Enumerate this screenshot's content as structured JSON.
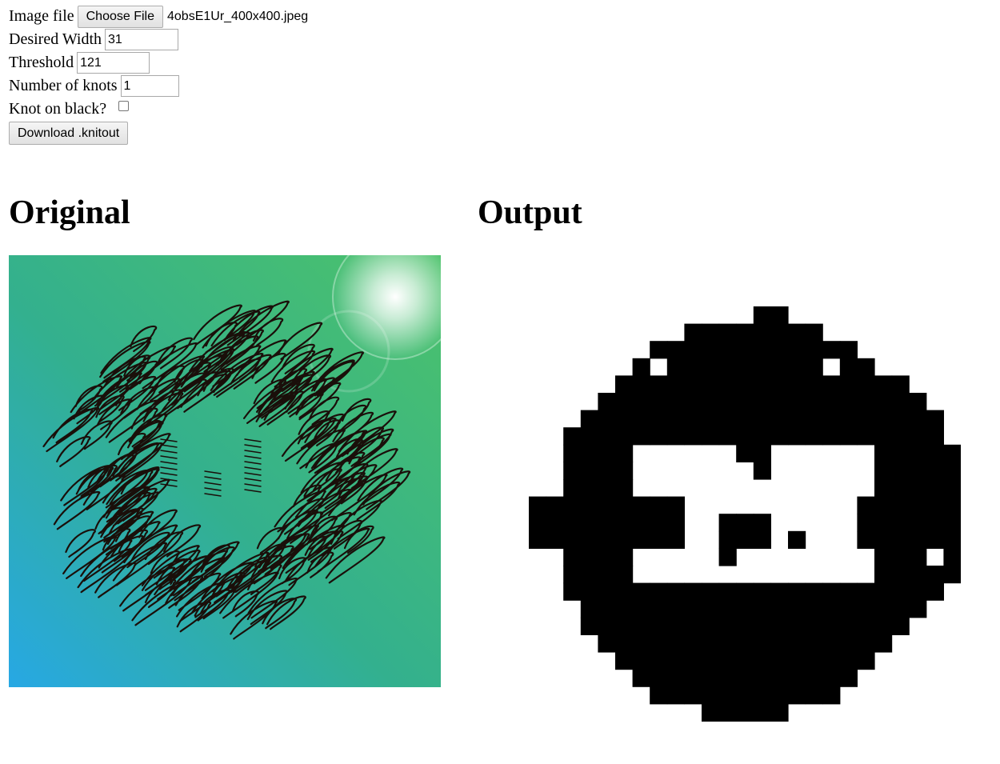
{
  "form": {
    "image_file_label": "Image file",
    "choose_file_button": "Choose File",
    "file_name": "4obsE1Ur_400x400.jpeg",
    "desired_width_label": "Desired Width",
    "desired_width_value": "31",
    "threshold_label": "Threshold",
    "threshold_value": "121",
    "knots_label": "Number of knots",
    "knots_value": "1",
    "knot_on_black_label": "Knot on black?",
    "knot_on_black_checked": false,
    "download_button": "Download .knitout"
  },
  "sections": {
    "original_heading": "Original",
    "output_heading": "Output"
  },
  "colors": {
    "original_gradient_top": "#3fbf7a",
    "original_gradient_bottom": "#2ba8e0",
    "scribble": "#1a0f0a",
    "output_foreground": "#000000",
    "output_background": "#ffffff"
  },
  "output_image": {
    "grid_columns": 25,
    "grid_rows": 25,
    "rows": [
      "0000000000000110000000000",
      "0000000001111111100000000",
      "0000000111111111111000000",
      "0000001011111111101100000",
      "0000011111111111111111000",
      "0000111111111111111111100",
      "0001111111111111111111110",
      "0011111111111111111111110",
      "0011110000001100000011111",
      "0011110000000100000011111",
      "0011110000000000000011111",
      "1111111110000000000111111",
      "1111111110011100000111111",
      "1111111110011101000111111",
      "0011110000010000000011101",
      "0011110000000000000011111",
      "0011111111111111111111110",
      "0001111111111111111111100",
      "0001111111111111111111000",
      "0000111111111111111110000",
      "0000011111111111111100000",
      "0000001111111111111000000",
      "0000000111111111110000000",
      "0000000000111110000000000",
      "0000000000000000000000000"
    ]
  }
}
